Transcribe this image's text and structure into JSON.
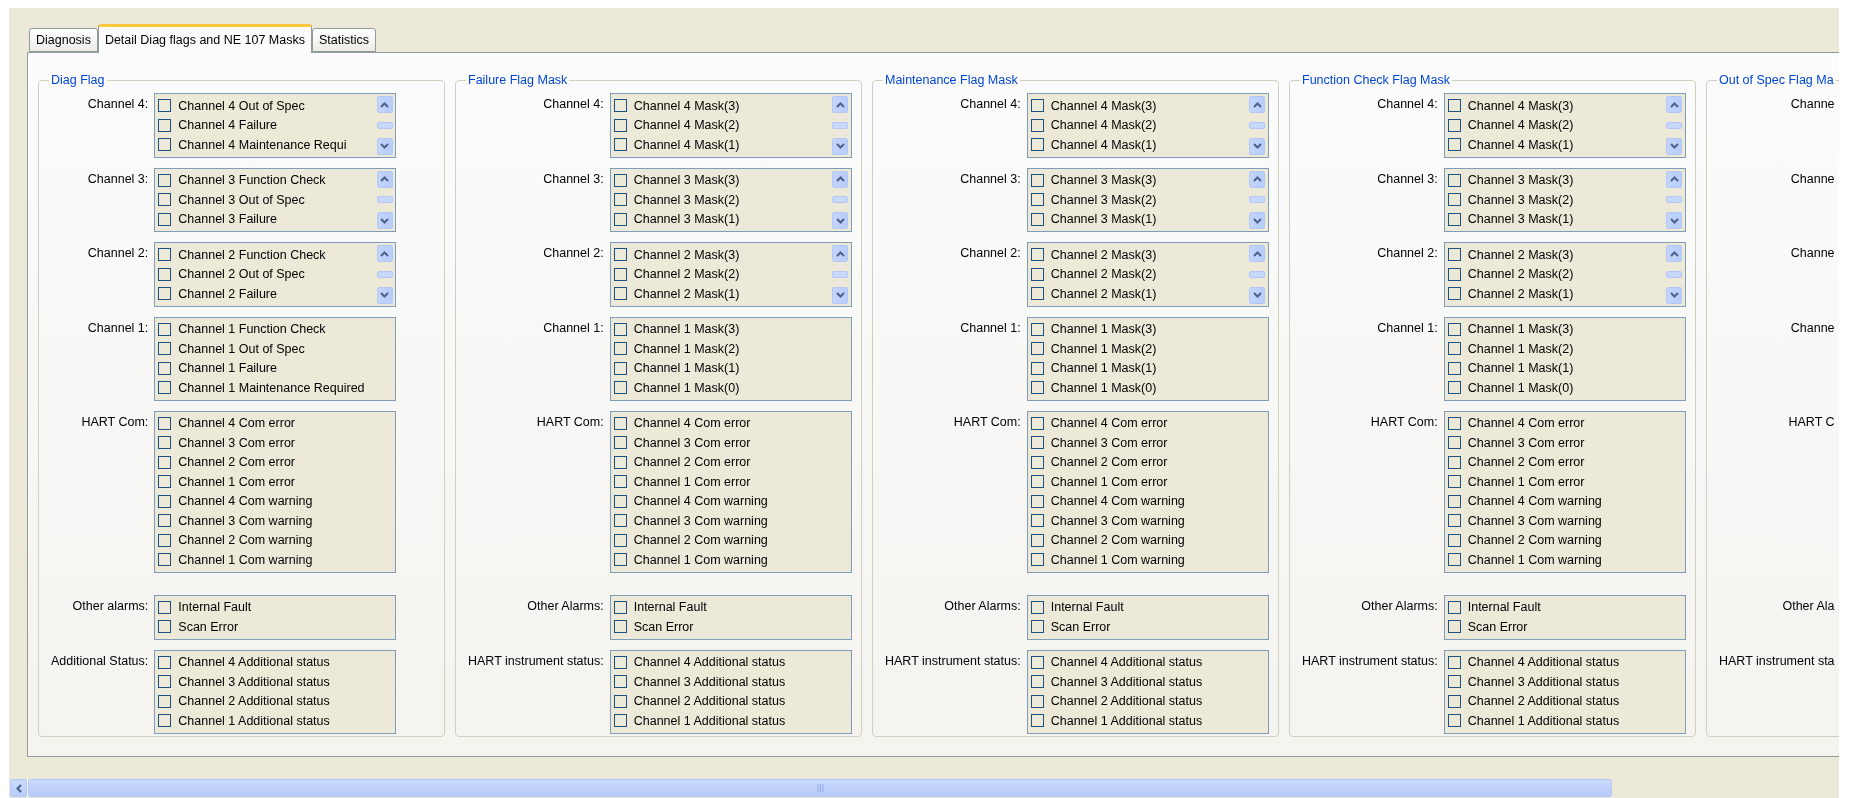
{
  "tabs": [
    {
      "label": "Diagnosis",
      "selected": false
    },
    {
      "label": "Detail Diag flags and NE 107 Masks",
      "selected": true
    },
    {
      "label": "Statistics",
      "selected": false
    }
  ],
  "groups": [
    {
      "title": "Diag Flag",
      "rows": [
        {
          "label": "Channel 4:",
          "scrollable": true,
          "items": [
            {
              "label": "Channel 4 Out of Spec",
              "checked": false
            },
            {
              "label": "Channel 4 Failure",
              "checked": false
            },
            {
              "label": "Channel 4 Maintenance Requi",
              "checked": false
            }
          ]
        },
        {
          "label": "Channel 3:",
          "scrollable": true,
          "items": [
            {
              "label": "Channel 3 Function Check",
              "checked": false
            },
            {
              "label": "Channel 3 Out of Spec",
              "checked": false
            },
            {
              "label": "Channel 3 Failure",
              "checked": false
            }
          ]
        },
        {
          "label": "Channel 2:",
          "scrollable": true,
          "items": [
            {
              "label": "Channel 2 Function Check",
              "checked": false
            },
            {
              "label": "Channel 2 Out of Spec",
              "checked": false
            },
            {
              "label": "Channel 2 Failure",
              "checked": false
            }
          ]
        },
        {
          "label": "Channel 1:",
          "scrollable": false,
          "items": [
            {
              "label": "Channel 1 Function Check",
              "checked": false
            },
            {
              "label": "Channel 1 Out of Spec",
              "checked": false
            },
            {
              "label": "Channel 1 Failure",
              "checked": false
            },
            {
              "label": "Channel 1 Maintenance Required",
              "checked": false
            }
          ]
        },
        {
          "label": "HART Com:",
          "scrollable": false,
          "items": [
            {
              "label": "Channel 4 Com error",
              "checked": false
            },
            {
              "label": "Channel 3 Com error",
              "checked": false
            },
            {
              "label": "Channel 2 Com error",
              "checked": false
            },
            {
              "label": "Channel 1 Com error",
              "checked": false
            },
            {
              "label": "Channel 4 Com warning",
              "checked": false
            },
            {
              "label": "Channel 3 Com warning",
              "checked": false
            },
            {
              "label": "Channel 2 Com warning",
              "checked": false
            },
            {
              "label": "Channel 1 Com warning",
              "checked": false
            }
          ]
        },
        {
          "label": "Other alarms:",
          "scrollable": false,
          "items": [
            {
              "label": "Internal Fault",
              "checked": false
            },
            {
              "label": "Scan Error",
              "checked": false
            }
          ]
        },
        {
          "label": "Additional Status:",
          "scrollable": false,
          "items": [
            {
              "label": "Channel 4 Additional status",
              "checked": false
            },
            {
              "label": "Channel 3 Additional status",
              "checked": false
            },
            {
              "label": "Channel 2 Additional status",
              "checked": false
            },
            {
              "label": "Channel 1 Additional status",
              "checked": false
            }
          ]
        }
      ]
    },
    {
      "title": "Failure Flag Mask",
      "rows": [
        {
          "label": "Channel 4:",
          "scrollable": true,
          "items": [
            {
              "label": "Channel 4 Mask(3)",
              "checked": false
            },
            {
              "label": "Channel 4 Mask(2)",
              "checked": false
            },
            {
              "label": "Channel 4 Mask(1)",
              "checked": false
            }
          ]
        },
        {
          "label": "Channel 3:",
          "scrollable": true,
          "items": [
            {
              "label": "Channel 3 Mask(3)",
              "checked": false
            },
            {
              "label": "Channel 3 Mask(2)",
              "checked": false
            },
            {
              "label": "Channel 3 Mask(1)",
              "checked": false
            }
          ]
        },
        {
          "label": "Channel 2:",
          "scrollable": true,
          "items": [
            {
              "label": "Channel 2 Mask(3)",
              "checked": false
            },
            {
              "label": "Channel 2 Mask(2)",
              "checked": false
            },
            {
              "label": "Channel 2 Mask(1)",
              "checked": false
            }
          ]
        },
        {
          "label": "Channel 1:",
          "scrollable": false,
          "items": [
            {
              "label": "Channel 1 Mask(3)",
              "checked": false
            },
            {
              "label": "Channel 1 Mask(2)",
              "checked": false
            },
            {
              "label": "Channel 1 Mask(1)",
              "checked": false
            },
            {
              "label": "Channel 1 Mask(0)",
              "checked": false
            }
          ]
        },
        {
          "label": "HART Com:",
          "scrollable": false,
          "items": [
            {
              "label": "Channel 4 Com error",
              "checked": false
            },
            {
              "label": "Channel 3 Com error",
              "checked": false
            },
            {
              "label": "Channel 2 Com error",
              "checked": false
            },
            {
              "label": "Channel 1 Com error",
              "checked": false
            },
            {
              "label": "Channel 4 Com warning",
              "checked": false
            },
            {
              "label": "Channel 3 Com warning",
              "checked": false
            },
            {
              "label": "Channel 2 Com warning",
              "checked": false
            },
            {
              "label": "Channel 1 Com warning",
              "checked": false
            }
          ]
        },
        {
          "label": "Other Alarms:",
          "scrollable": false,
          "items": [
            {
              "label": "Internal Fault",
              "checked": false
            },
            {
              "label": "Scan Error",
              "checked": false
            }
          ]
        },
        {
          "label": "HART instrument status:",
          "scrollable": false,
          "items": [
            {
              "label": "Channel 4 Additional status",
              "checked": false
            },
            {
              "label": "Channel 3 Additional status",
              "checked": false
            },
            {
              "label": "Channel 2 Additional status",
              "checked": false
            },
            {
              "label": "Channel 1 Additional status",
              "checked": false
            }
          ]
        }
      ]
    },
    {
      "title": "Maintenance Flag Mask",
      "rows": [
        {
          "label": "Channel 4:",
          "scrollable": true,
          "items": [
            {
              "label": "Channel 4 Mask(3)",
              "checked": false
            },
            {
              "label": "Channel 4 Mask(2)",
              "checked": false
            },
            {
              "label": "Channel 4 Mask(1)",
              "checked": false
            }
          ]
        },
        {
          "label": "Channel 3:",
          "scrollable": true,
          "items": [
            {
              "label": "Channel 3 Mask(3)",
              "checked": false
            },
            {
              "label": "Channel 3 Mask(2)",
              "checked": false
            },
            {
              "label": "Channel 3 Mask(1)",
              "checked": false
            }
          ]
        },
        {
          "label": "Channel 2:",
          "scrollable": true,
          "items": [
            {
              "label": "Channel 2 Mask(3)",
              "checked": false
            },
            {
              "label": "Channel 2 Mask(2)",
              "checked": false
            },
            {
              "label": "Channel 2 Mask(1)",
              "checked": false
            }
          ]
        },
        {
          "label": "Channel 1:",
          "scrollable": false,
          "items": [
            {
              "label": "Channel 1 Mask(3)",
              "checked": false
            },
            {
              "label": "Channel 1 Mask(2)",
              "checked": false
            },
            {
              "label": "Channel 1 Mask(1)",
              "checked": false
            },
            {
              "label": "Channel 1 Mask(0)",
              "checked": false
            }
          ]
        },
        {
          "label": "HART Com:",
          "scrollable": false,
          "items": [
            {
              "label": "Channel 4 Com error",
              "checked": false
            },
            {
              "label": "Channel 3 Com error",
              "checked": false
            },
            {
              "label": "Channel 2 Com error",
              "checked": false
            },
            {
              "label": "Channel 1 Com error",
              "checked": false
            },
            {
              "label": "Channel 4 Com warning",
              "checked": false
            },
            {
              "label": "Channel 3 Com warning",
              "checked": false
            },
            {
              "label": "Channel 2 Com warning",
              "checked": false
            },
            {
              "label": "Channel 1 Com warning",
              "checked": false
            }
          ]
        },
        {
          "label": "Other Alarms:",
          "scrollable": false,
          "items": [
            {
              "label": "Internal Fault",
              "checked": false
            },
            {
              "label": "Scan Error",
              "checked": false
            }
          ]
        },
        {
          "label": "HART instrument status:",
          "scrollable": false,
          "items": [
            {
              "label": "Channel 4 Additional status",
              "checked": false
            },
            {
              "label": "Channel 3 Additional status",
              "checked": false
            },
            {
              "label": "Channel 2 Additional status",
              "checked": false
            },
            {
              "label": "Channel 1 Additional status",
              "checked": false
            }
          ]
        }
      ]
    },
    {
      "title": "Function Check Flag Mask",
      "rows": [
        {
          "label": "Channel 4:",
          "scrollable": true,
          "items": [
            {
              "label": "Channel 4 Mask(3)",
              "checked": false
            },
            {
              "label": "Channel 4 Mask(2)",
              "checked": false
            },
            {
              "label": "Channel 4 Mask(1)",
              "checked": false
            }
          ]
        },
        {
          "label": "Channel 3:",
          "scrollable": true,
          "items": [
            {
              "label": "Channel 3 Mask(3)",
              "checked": false
            },
            {
              "label": "Channel 3 Mask(2)",
              "checked": false
            },
            {
              "label": "Channel 3 Mask(1)",
              "checked": false
            }
          ]
        },
        {
          "label": "Channel 2:",
          "scrollable": true,
          "items": [
            {
              "label": "Channel 2 Mask(3)",
              "checked": false
            },
            {
              "label": "Channel 2 Mask(2)",
              "checked": false
            },
            {
              "label": "Channel 2 Mask(1)",
              "checked": false
            }
          ]
        },
        {
          "label": "Channel 1:",
          "scrollable": false,
          "items": [
            {
              "label": "Channel 1 Mask(3)",
              "checked": false
            },
            {
              "label": "Channel 1 Mask(2)",
              "checked": false
            },
            {
              "label": "Channel 1 Mask(1)",
              "checked": false
            },
            {
              "label": "Channel 1 Mask(0)",
              "checked": false
            }
          ]
        },
        {
          "label": "HART Com:",
          "scrollable": false,
          "items": [
            {
              "label": "Channel 4 Com error",
              "checked": false
            },
            {
              "label": "Channel 3 Com error",
              "checked": false
            },
            {
              "label": "Channel 2 Com error",
              "checked": false
            },
            {
              "label": "Channel 1 Com error",
              "checked": false
            },
            {
              "label": "Channel 4 Com warning",
              "checked": false
            },
            {
              "label": "Channel 3 Com warning",
              "checked": false
            },
            {
              "label": "Channel 2 Com warning",
              "checked": false
            },
            {
              "label": "Channel 1 Com warning",
              "checked": false
            }
          ]
        },
        {
          "label": "Other Alarms:",
          "scrollable": false,
          "items": [
            {
              "label": "Internal Fault",
              "checked": false
            },
            {
              "label": "Scan Error",
              "checked": false
            }
          ]
        },
        {
          "label": "HART instrument status:",
          "scrollable": false,
          "items": [
            {
              "label": "Channel 4 Additional status",
              "checked": false
            },
            {
              "label": "Channel 3 Additional status",
              "checked": false
            },
            {
              "label": "Channel 2 Additional status",
              "checked": false
            },
            {
              "label": "Channel 1 Additional status",
              "checked": false
            }
          ]
        }
      ]
    },
    {
      "title": "Out of Spec Flag Ma",
      "rows": [
        {
          "label": "Channe"
        },
        {
          "label": "Channe"
        },
        {
          "label": "Channe"
        },
        {
          "label": "Channe"
        },
        {
          "label": "HART C"
        },
        {
          "label": "Other Ala"
        },
        {
          "label": "HART instrument sta"
        }
      ]
    }
  ]
}
